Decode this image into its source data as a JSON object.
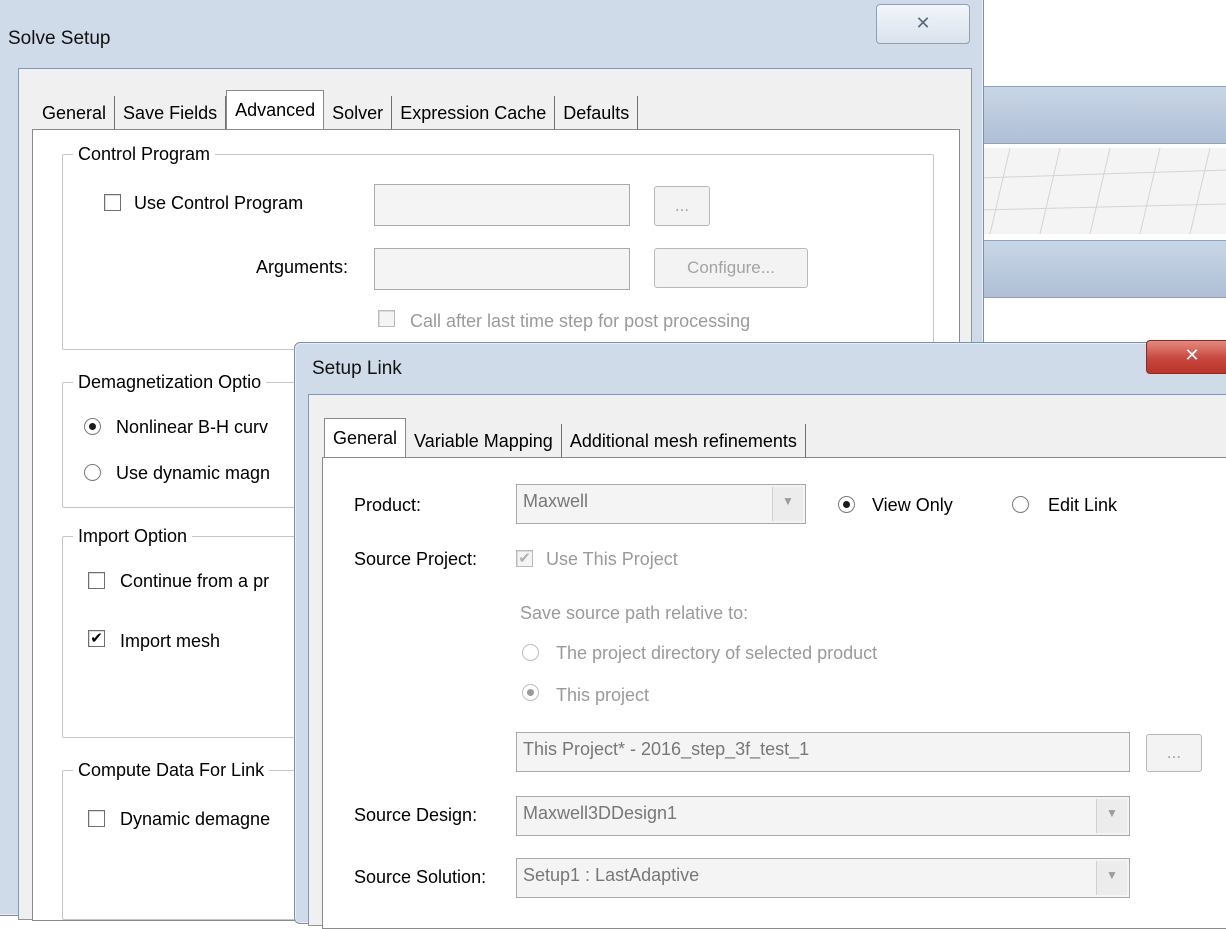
{
  "solve_setup": {
    "title": "Solve Setup",
    "tabs": [
      "General",
      "Save Fields",
      "Advanced",
      "Solver",
      "Expression Cache",
      "Defaults"
    ],
    "active_tab": "Advanced",
    "control_program": {
      "group_title": "Control Program",
      "use_label": "Use Control Program",
      "browse_label": "...",
      "arguments_label": "Arguments:",
      "configure_label": "Configure...",
      "call_after_label": "Call after last time step for post processing"
    },
    "demag": {
      "group_title": "Demagnetization Optio",
      "nonlinear_label": "Nonlinear B-H curv",
      "dynamic_label": "Use dynamic magn"
    },
    "import": {
      "group_title": "Import Option",
      "continue_label": "Continue from a pr",
      "mesh_label": "Import mesh",
      "mesh_checked": true
    },
    "compute": {
      "group_title": "Compute Data For Link",
      "dynamic_label": "Dynamic demagne"
    }
  },
  "setup_link": {
    "title": "Setup Link",
    "tabs": [
      "General",
      "Variable Mapping",
      "Additional mesh refinements"
    ],
    "active_tab": "General",
    "product_label": "Product:",
    "product_value": "Maxwell",
    "view_only_label": "View Only",
    "edit_link_label": "Edit Link",
    "source_project_label": "Source Project:",
    "use_this_project_label": "Use This Project",
    "save_relative_label": "Save source path relative to:",
    "project_dir_label": "The project directory of selected product",
    "this_project_label": "This project",
    "project_path_value": "This Project* - 2016_step_3f_test_1",
    "browse_label": "...",
    "source_design_label": "Source Design:",
    "source_design_value": "Maxwell3DDesign1",
    "source_solution_label": "Source Solution:",
    "source_solution_value": "Setup1 : LastAdaptive"
  },
  "icons": {
    "close": "close-icon",
    "dropdown": "chevron-down-icon"
  },
  "colors": {
    "frame": "#cfdbe9",
    "close_red": "#c9463d"
  }
}
